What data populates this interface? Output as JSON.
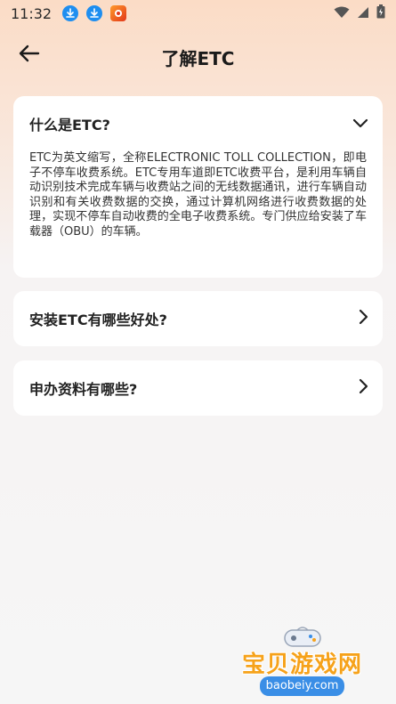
{
  "status_bar": {
    "time": "11:32",
    "left_icons": [
      "download-icon",
      "download-icon",
      "app-notification-icon"
    ],
    "right_icons": [
      "wifi-icon",
      "signal-icon",
      "battery-icon"
    ]
  },
  "nav": {
    "back_icon": "arrow-left-icon",
    "title": "了解ETC"
  },
  "faq": [
    {
      "question": "什么是ETC?",
      "expanded": true,
      "chevron": "chevron-down-icon",
      "answer": "ETC为英文缩写，全称ELECTRONIC TOLL COLLECTION，即电子不停车收费系统。ETC专用车道即ETC收费平台，是利用车辆自动识别技术完成车辆与收费站之间的无线数据通讯，进行车辆自动识别和有关收费数据的交换，通过计算机网络进行收费数据的处理，实现不停车自动收费的全电子收费系统。专门供应给安装了车载器（OBU）的车辆。"
    },
    {
      "question": "安装ETC有哪些好处?",
      "expanded": false,
      "chevron": "chevron-right-icon"
    },
    {
      "question": "申办资料有哪些?",
      "expanded": false,
      "chevron": "chevron-right-icon"
    }
  ],
  "watermark": {
    "text": "宝贝游戏网",
    "url": "baobeiy.com"
  },
  "colors": {
    "header_gradient_top": "#fbdcc6",
    "background": "#f6f6f6",
    "card": "#ffffff",
    "download_icon": "#1e8ef0",
    "watermark_text": "#f6a21a",
    "watermark_url_bg": "#3a8ee6"
  }
}
